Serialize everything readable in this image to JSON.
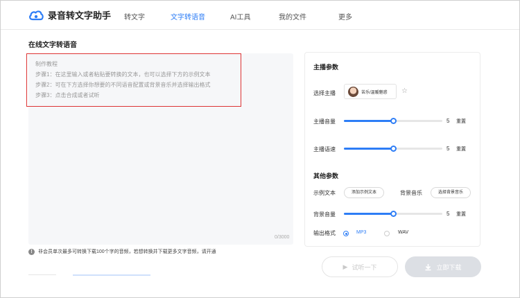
{
  "app": {
    "title": "录音转文字助手",
    "logo_icon": "cloud-icon",
    "accent_color": "#2d7df6"
  },
  "nav": {
    "items": [
      {
        "label": "转文字",
        "active": false
      },
      {
        "label": "文字转语音",
        "active": true
      },
      {
        "label": "AI工具",
        "active": false
      },
      {
        "label": "我的文件",
        "active": false
      },
      {
        "label": "更多",
        "active": false
      }
    ]
  },
  "page": {
    "title": "在线文字转语音"
  },
  "editor": {
    "tutorial": {
      "heading": "制作教程",
      "steps": [
        "步骤1：在这里输入或者粘贴要转换的文本，也可以选择下方的示例文本",
        "步骤2：可在下方选择你想要的不同语音配置或背景音乐并选择输出格式",
        "步骤3：点击合成或者试听"
      ],
      "highlight_color": "#dd3333"
    },
    "counter": "0/3000"
  },
  "notice": {
    "icon": "info-icon",
    "text": "非会员单次最多可转换下载100个字的音频，若想转换并下载更多文字音频，请开通"
  },
  "anchor_params": {
    "title": "主播参数",
    "select_label": "选择主播",
    "voice_name": "苦乐/温暖魅惑",
    "favorite_icon": "star-icon",
    "volume": {
      "label": "主播音量",
      "value": "5",
      "level": 0.5,
      "reset": "重置"
    },
    "speed": {
      "label": "主播语速",
      "value": "5",
      "level": 0.5,
      "reset": "重置"
    }
  },
  "other_params": {
    "title": "其他参数",
    "sample_label": "示例文本",
    "sample_button": "添加示例文本",
    "bgm_label": "背景音乐",
    "bgm_button": "选择背景音乐",
    "bg_volume": {
      "label": "背景音量",
      "value": "5",
      "level": 0.5,
      "reset": "重置"
    },
    "format_label": "输出格式",
    "formats": [
      {
        "label": "MP3",
        "selected": true
      },
      {
        "label": "WAV",
        "selected": false
      }
    ]
  },
  "actions": {
    "listen": {
      "label": "试听一下",
      "icon": "play-icon"
    },
    "download": {
      "label": "立即下载",
      "icon": "download-icon"
    }
  }
}
